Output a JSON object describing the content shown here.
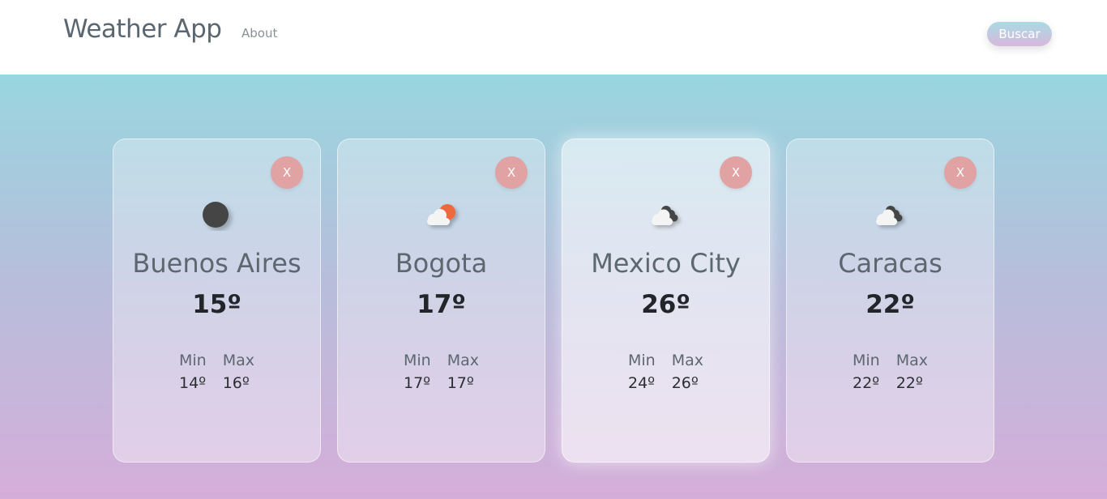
{
  "app": {
    "title": "Weather App",
    "nav_about": "About",
    "search_label": "Buscar"
  },
  "cards": [
    {
      "city": "Buenos Aires",
      "temp": "15º",
      "min_label": "Min",
      "max_label": "Max",
      "min": "14º",
      "max": "16º",
      "icon": "night-moon-icon",
      "close": "X"
    },
    {
      "city": "Bogota",
      "temp": "17º",
      "min_label": "Min",
      "max_label": "Max",
      "min": "17º",
      "max": "17º",
      "icon": "sun-cloud-icon",
      "close": "X"
    },
    {
      "city": "Mexico City",
      "temp": "26º",
      "min_label": "Min",
      "max_label": "Max",
      "min": "24º",
      "max": "26º",
      "icon": "dark-clouds-icon",
      "close": "X"
    },
    {
      "city": "Caracas",
      "temp": "22º",
      "min_label": "Min",
      "max_label": "Max",
      "min": "22º",
      "max": "22º",
      "icon": "dark-clouds-icon",
      "close": "X"
    }
  ],
  "colors": {
    "close_button": "#e0a2a3",
    "gradient_top": "#99d6df",
    "gradient_bottom": "#d5aed9",
    "search_button_top": "#a9dbe4",
    "search_button_bottom": "#d8b7dd"
  }
}
